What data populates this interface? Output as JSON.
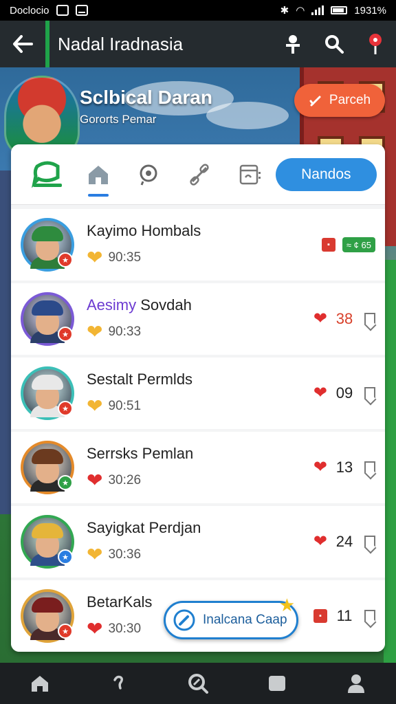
{
  "status_bar": {
    "left_text": "Doclocio",
    "right_text": "1931%"
  },
  "app_bar": {
    "title": "Nadal Iradnasia"
  },
  "hero": {
    "title": "Sclbical Daran",
    "subtitle": "Gororts Pemar",
    "button_label": "Parceh"
  },
  "tabs": {
    "pill_label": "Nandos",
    "icons": [
      "chat-bubble-icon",
      "home-icon",
      "target-icon",
      "link-icon",
      "document-icon"
    ],
    "active_index": 1
  },
  "players": [
    {
      "name": "Kayimo Hombals",
      "name_highlight": "",
      "time": "90:35",
      "count": "",
      "tag": "65",
      "tag_icon": "≈ ¢",
      "avatar_color": "#3a9ee0",
      "cap_color": "#2e8b3e",
      "body_color": "#2e7d3a",
      "badge_color": "#e03a2a"
    },
    {
      "name": " Sovdah",
      "name_highlight": "Aesimy",
      "time": "90:33",
      "count": "38",
      "avatar_color": "#7b5ad6",
      "cap_color": "#2b4a8a",
      "body_color": "#2b3f6a",
      "badge_color": "#e03a2a"
    },
    {
      "name": "Sestalt Permlds",
      "name_highlight": "",
      "time": "90:51",
      "count": "09",
      "avatar_color": "#3bbfb7",
      "cap_color": "#e8e8e8",
      "body_color": "#e6e6e6",
      "badge_color": "#e03a2a"
    },
    {
      "name": "Serrsks Pemlan",
      "name_highlight": "",
      "time": "30:26",
      "count": "13",
      "avatar_color": "#e48a2a",
      "cap_color": "#6b3a1f",
      "body_color": "#2a2a2a",
      "badge_color": "#2fa046"
    },
    {
      "name": "Sayigkat Perdjan",
      "name_highlight": "",
      "time": "30:36",
      "count": "24",
      "avatar_color": "#32a852",
      "cap_color": "#e5b53a",
      "body_color": "#2e4f8a",
      "badge_color": "#2a7de1"
    },
    {
      "name": "BetarKals",
      "name_highlight": "",
      "time": "30:30",
      "count": "11",
      "avatar_color": "#e0a43a",
      "cap_color": "#7a1e1e",
      "body_color": "#4a2a2a",
      "badge_color": "#e03a2a"
    }
  ],
  "floating_chip": {
    "label": "Inalcana Caap"
  },
  "bottom_nav": [
    "home-icon",
    "question-icon",
    "search-icon",
    "square-icon",
    "profile-icon"
  ],
  "colors": {
    "accent_green": "#1fa34a",
    "accent_blue": "#2f8fe0",
    "hero_button": "#f0623a",
    "heart_red": "#e02e2e"
  }
}
